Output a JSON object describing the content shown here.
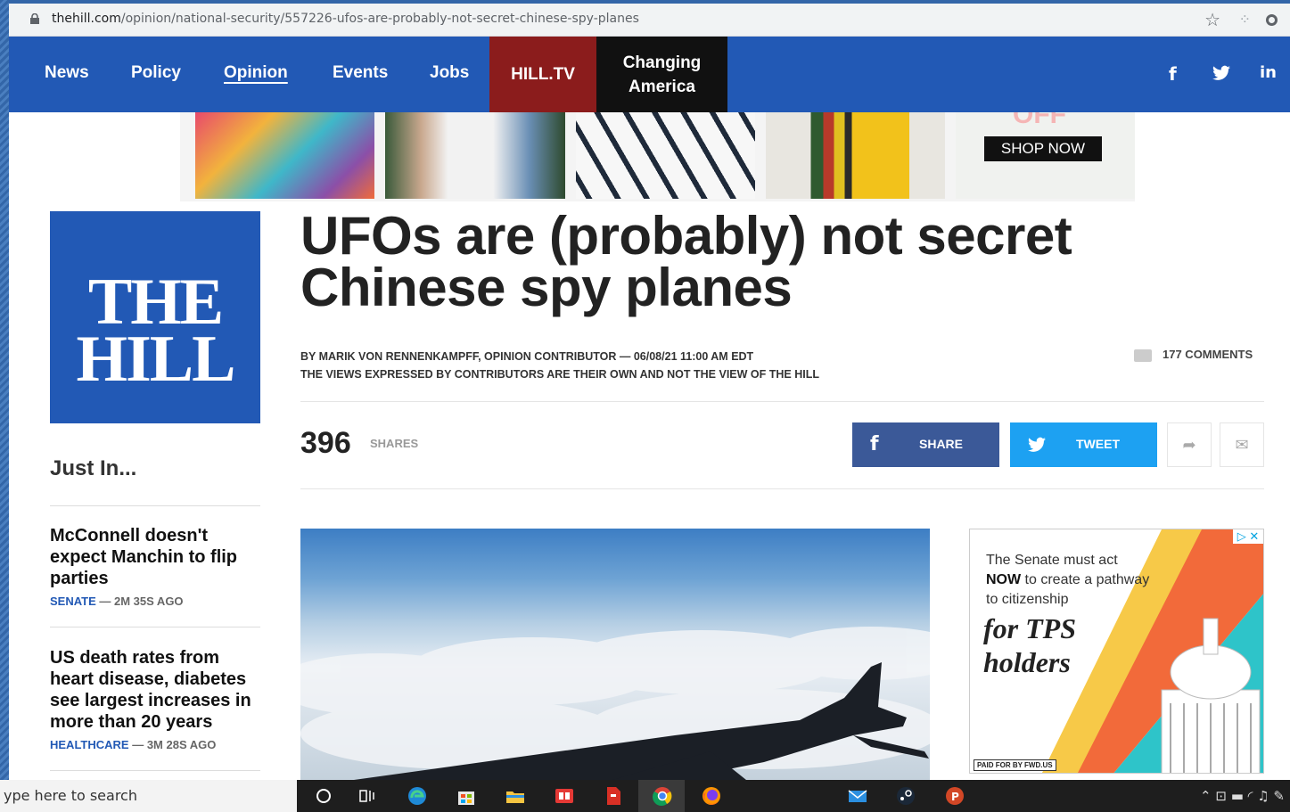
{
  "browser": {
    "url_host": "thehill.com",
    "url_path": "/opinion/national-security/557226-ufos-are-probably-not-secret-chinese-spy-planes"
  },
  "nav": {
    "items": [
      "News",
      "Policy",
      "Opinion",
      "Events",
      "Jobs"
    ],
    "active": "Opinion",
    "hilltv": "HILL.TV",
    "changing_line1": "Changing",
    "changing_line2": "America",
    "social": [
      "f",
      "t",
      "in"
    ]
  },
  "banner": {
    "shop_now": "SHOP NOW",
    "partial_text": "OFF"
  },
  "logo": {
    "line1": "THE",
    "line2": "HILL"
  },
  "sidebar": {
    "heading": "Just In...",
    "items": [
      {
        "title": "McConnell doesn't expect Manchin to flip parties",
        "category": "SENATE",
        "age": "— 2M 35S AGO"
      },
      {
        "title": "US death rates from heart disease, diabetes see largest increases in more than 20 years",
        "category": "HEALTHCARE",
        "age": "— 3M 28S AGO"
      }
    ]
  },
  "article": {
    "headline": "UFOs are (probably) not secret Chinese spy planes",
    "byline": "BY MARIK VON RENNENKAMPFF, OPINION CONTRIBUTOR — 06/08/21 11:00 AM EDT",
    "disclaimer": "THE VIEWS EXPRESSED BY CONTRIBUTORS ARE THEIR OWN AND NOT THE VIEW OF THE HILL",
    "comments": "177 COMMENTS",
    "shares_count": "396",
    "shares_label": "SHARES",
    "share_fb": "SHARE",
    "share_tw": "TWEET"
  },
  "side_ad": {
    "line1": "The Senate must act",
    "now": "NOW",
    "line2_rest": " to create a pathway",
    "line3": "to citizenship",
    "big1": "for TPS",
    "big2": "holders",
    "paid": "PAID FOR BY FWD.US",
    "adchoices": "▷ ✕"
  },
  "taskbar": {
    "search_placeholder": "ype here to search"
  },
  "colors": {
    "brand_blue": "#2259b5",
    "hilltv_red": "#8b1c1c",
    "facebook": "#3b5998",
    "twitter": "#1da1f2"
  }
}
